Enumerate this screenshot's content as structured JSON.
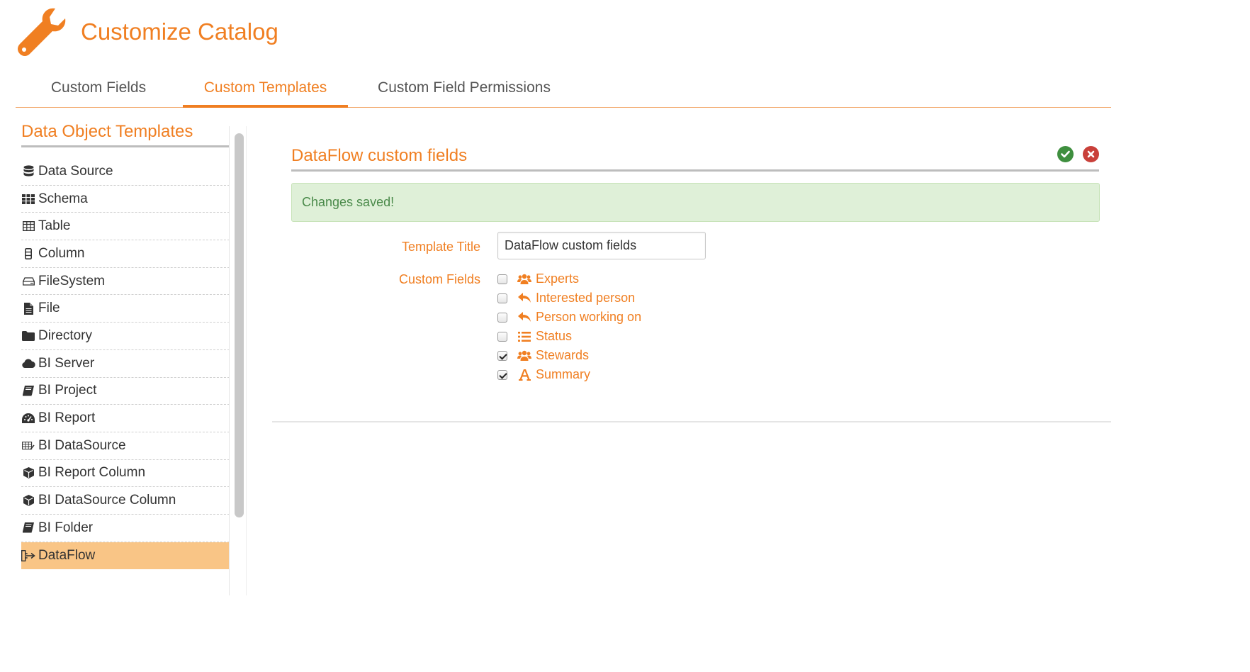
{
  "header": {
    "title": "Customize Catalog",
    "icon": "wrench-icon"
  },
  "tabs": [
    {
      "label": "Custom Fields",
      "active": false
    },
    {
      "label": "Custom Templates",
      "active": true
    },
    {
      "label": "Custom Field Permissions",
      "active": false
    }
  ],
  "sidebar": {
    "title": "Data Object Templates",
    "items": [
      {
        "label": "Data Source",
        "icon": "database-icon"
      },
      {
        "label": "Schema",
        "icon": "grid-icon"
      },
      {
        "label": "Table",
        "icon": "table-icon"
      },
      {
        "label": "Column",
        "icon": "column-icon"
      },
      {
        "label": "FileSystem",
        "icon": "hdd-icon"
      },
      {
        "label": "File",
        "icon": "file-icon"
      },
      {
        "label": "Directory",
        "icon": "folder-icon"
      },
      {
        "label": "BI Server",
        "icon": "cloud-icon"
      },
      {
        "label": "BI Project",
        "icon": "book-icon"
      },
      {
        "label": "BI Report",
        "icon": "dashboard-icon"
      },
      {
        "label": "BI DataSource",
        "icon": "datasource-icon"
      },
      {
        "label": "BI Report Column",
        "icon": "cube-icon"
      },
      {
        "label": "BI DataSource Column",
        "icon": "cube-icon"
      },
      {
        "label": "BI Folder",
        "icon": "book-icon"
      },
      {
        "label": "DataFlow",
        "icon": "dataflow-icon",
        "active": true
      }
    ]
  },
  "panel": {
    "title": "DataFlow custom fields",
    "alert": "Changes saved!",
    "template_title_label": "Template Title",
    "template_title_value": "DataFlow custom fields",
    "custom_fields_label": "Custom Fields",
    "fields": [
      {
        "label": "Experts",
        "icon": "users-icon",
        "checked": false
      },
      {
        "label": "Interested person",
        "icon": "reply-icon",
        "checked": false
      },
      {
        "label": "Person working on",
        "icon": "reply-icon",
        "checked": false
      },
      {
        "label": "Status",
        "icon": "list-icon",
        "checked": false
      },
      {
        "label": "Stewards",
        "icon": "users-icon",
        "checked": true
      },
      {
        "label": "Summary",
        "icon": "font-icon",
        "checked": true
      }
    ]
  },
  "colors": {
    "accent": "#f07f22",
    "active_row": "#f9c586",
    "success": "#3f8f3f",
    "danger": "#c9403a",
    "alert_bg": "#dff0d8"
  }
}
